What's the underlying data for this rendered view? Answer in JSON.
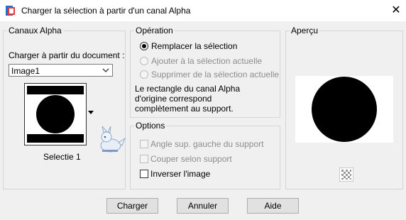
{
  "window": {
    "title": "Charger la sélection à partir d'un canal Alpha",
    "close_glyph": "✕"
  },
  "canaux": {
    "group_label": "Canaux Alpha",
    "doc_label": "Charger à partir du document :",
    "doc_value": "Image1",
    "channel_name": "Selectie 1"
  },
  "operation": {
    "group_label": "Opération",
    "options": [
      {
        "label": "Remplacer la sélection",
        "selected": true,
        "enabled": true
      },
      {
        "label": "Ajouter à la sélection actuelle",
        "selected": false,
        "enabled": false
      },
      {
        "label": "Supprimer de la sélection actuelle",
        "selected": false,
        "enabled": false
      }
    ],
    "info_line1": "Le rectangle du canal Alpha",
    "info_line2": "d'origine correspond",
    "info_line3": "complètement au support."
  },
  "options": {
    "group_label": "Options",
    "items": [
      {
        "label": "Angle sup. gauche du support",
        "checked": false,
        "enabled": false
      },
      {
        "label": "Couper selon support",
        "checked": false,
        "enabled": false
      },
      {
        "label": "Inverser l'image",
        "checked": false,
        "enabled": true
      }
    ]
  },
  "apercu": {
    "group_label": "Aperçu"
  },
  "buttons": {
    "charger": "Charger",
    "annuler": "Annuler",
    "aide": "Aide"
  },
  "icons": {
    "app": "paintshop-app-icon",
    "close": "close-icon",
    "dropdown": "chevron-down-icon",
    "thumb_dropdown": "caret-down-icon",
    "mascot": "mascot-icon",
    "transparency": "checkerboard-icon"
  }
}
